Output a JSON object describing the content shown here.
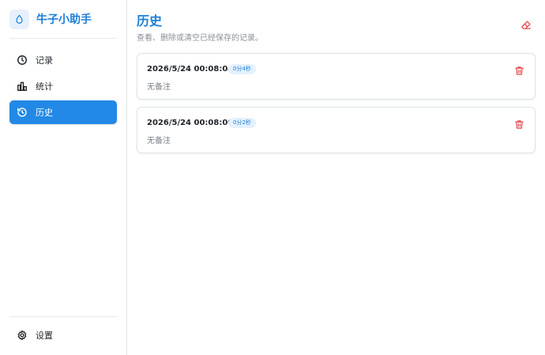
{
  "app": {
    "name": "牛子小助手",
    "icon": "droplet-icon",
    "accent_color": "#1e7fd8",
    "active_nav_color": "#2389e6",
    "danger_color": "#e5484d"
  },
  "sidebar": {
    "items": [
      {
        "label": "记录",
        "icon": "clock-icon",
        "active": false
      },
      {
        "label": "统计",
        "icon": "bar-chart-icon",
        "active": false
      },
      {
        "label": "历史",
        "icon": "history-icon",
        "active": true
      }
    ],
    "settings": {
      "label": "设置",
      "icon": "gear-icon"
    }
  },
  "page": {
    "title": "历史",
    "subtitle": "查看、删除或清空已经保存的记录。",
    "clear_icon": "eraser-icon"
  },
  "history": [
    {
      "datetime": "2026/5/24 00:08:04",
      "duration": "0分4秒",
      "note": "无备注",
      "delete_icon": "trash-icon"
    },
    {
      "datetime": "2026/5/24 00:08:00",
      "duration": "0分2秒",
      "note": "无备注",
      "delete_icon": "trash-icon"
    }
  ]
}
